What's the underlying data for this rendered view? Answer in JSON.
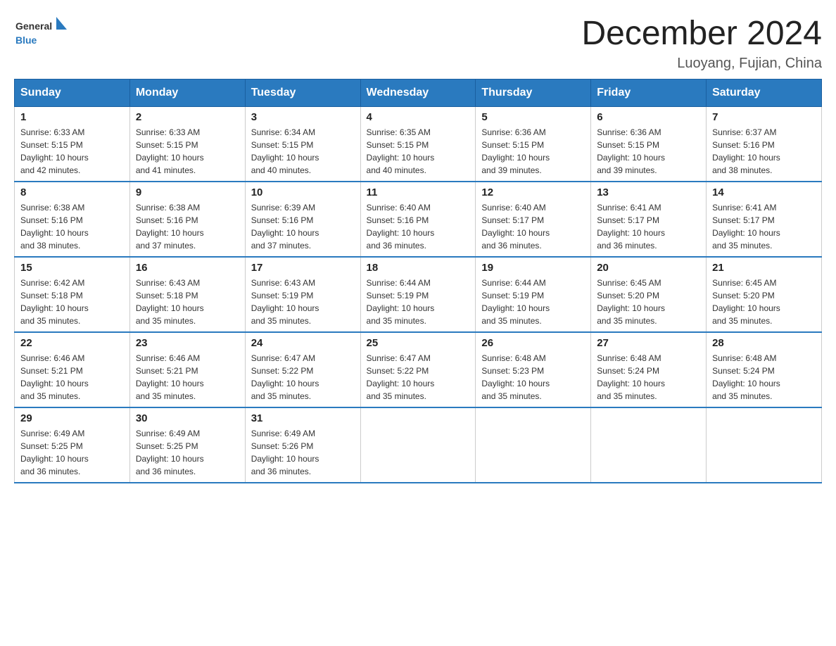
{
  "header": {
    "logo_general": "General",
    "logo_blue": "Blue",
    "month_title": "December 2024",
    "location": "Luoyang, Fujian, China"
  },
  "days_of_week": [
    "Sunday",
    "Monday",
    "Tuesday",
    "Wednesday",
    "Thursday",
    "Friday",
    "Saturday"
  ],
  "weeks": [
    [
      {
        "day": "1",
        "sunrise": "6:33 AM",
        "sunset": "5:15 PM",
        "daylight": "10 hours and 42 minutes."
      },
      {
        "day": "2",
        "sunrise": "6:33 AM",
        "sunset": "5:15 PM",
        "daylight": "10 hours and 41 minutes."
      },
      {
        "day": "3",
        "sunrise": "6:34 AM",
        "sunset": "5:15 PM",
        "daylight": "10 hours and 40 minutes."
      },
      {
        "day": "4",
        "sunrise": "6:35 AM",
        "sunset": "5:15 PM",
        "daylight": "10 hours and 40 minutes."
      },
      {
        "day": "5",
        "sunrise": "6:36 AM",
        "sunset": "5:15 PM",
        "daylight": "10 hours and 39 minutes."
      },
      {
        "day": "6",
        "sunrise": "6:36 AM",
        "sunset": "5:15 PM",
        "daylight": "10 hours and 39 minutes."
      },
      {
        "day": "7",
        "sunrise": "6:37 AM",
        "sunset": "5:16 PM",
        "daylight": "10 hours and 38 minutes."
      }
    ],
    [
      {
        "day": "8",
        "sunrise": "6:38 AM",
        "sunset": "5:16 PM",
        "daylight": "10 hours and 38 minutes."
      },
      {
        "day": "9",
        "sunrise": "6:38 AM",
        "sunset": "5:16 PM",
        "daylight": "10 hours and 37 minutes."
      },
      {
        "day": "10",
        "sunrise": "6:39 AM",
        "sunset": "5:16 PM",
        "daylight": "10 hours and 37 minutes."
      },
      {
        "day": "11",
        "sunrise": "6:40 AM",
        "sunset": "5:16 PM",
        "daylight": "10 hours and 36 minutes."
      },
      {
        "day": "12",
        "sunrise": "6:40 AM",
        "sunset": "5:17 PM",
        "daylight": "10 hours and 36 minutes."
      },
      {
        "day": "13",
        "sunrise": "6:41 AM",
        "sunset": "5:17 PM",
        "daylight": "10 hours and 36 minutes."
      },
      {
        "day": "14",
        "sunrise": "6:41 AM",
        "sunset": "5:17 PM",
        "daylight": "10 hours and 35 minutes."
      }
    ],
    [
      {
        "day": "15",
        "sunrise": "6:42 AM",
        "sunset": "5:18 PM",
        "daylight": "10 hours and 35 minutes."
      },
      {
        "day": "16",
        "sunrise": "6:43 AM",
        "sunset": "5:18 PM",
        "daylight": "10 hours and 35 minutes."
      },
      {
        "day": "17",
        "sunrise": "6:43 AM",
        "sunset": "5:19 PM",
        "daylight": "10 hours and 35 minutes."
      },
      {
        "day": "18",
        "sunrise": "6:44 AM",
        "sunset": "5:19 PM",
        "daylight": "10 hours and 35 minutes."
      },
      {
        "day": "19",
        "sunrise": "6:44 AM",
        "sunset": "5:19 PM",
        "daylight": "10 hours and 35 minutes."
      },
      {
        "day": "20",
        "sunrise": "6:45 AM",
        "sunset": "5:20 PM",
        "daylight": "10 hours and 35 minutes."
      },
      {
        "day": "21",
        "sunrise": "6:45 AM",
        "sunset": "5:20 PM",
        "daylight": "10 hours and 35 minutes."
      }
    ],
    [
      {
        "day": "22",
        "sunrise": "6:46 AM",
        "sunset": "5:21 PM",
        "daylight": "10 hours and 35 minutes."
      },
      {
        "day": "23",
        "sunrise": "6:46 AM",
        "sunset": "5:21 PM",
        "daylight": "10 hours and 35 minutes."
      },
      {
        "day": "24",
        "sunrise": "6:47 AM",
        "sunset": "5:22 PM",
        "daylight": "10 hours and 35 minutes."
      },
      {
        "day": "25",
        "sunrise": "6:47 AM",
        "sunset": "5:22 PM",
        "daylight": "10 hours and 35 minutes."
      },
      {
        "day": "26",
        "sunrise": "6:48 AM",
        "sunset": "5:23 PM",
        "daylight": "10 hours and 35 minutes."
      },
      {
        "day": "27",
        "sunrise": "6:48 AM",
        "sunset": "5:24 PM",
        "daylight": "10 hours and 35 minutes."
      },
      {
        "day": "28",
        "sunrise": "6:48 AM",
        "sunset": "5:24 PM",
        "daylight": "10 hours and 35 minutes."
      }
    ],
    [
      {
        "day": "29",
        "sunrise": "6:49 AM",
        "sunset": "5:25 PM",
        "daylight": "10 hours and 36 minutes."
      },
      {
        "day": "30",
        "sunrise": "6:49 AM",
        "sunset": "5:25 PM",
        "daylight": "10 hours and 36 minutes."
      },
      {
        "day": "31",
        "sunrise": "6:49 AM",
        "sunset": "5:26 PM",
        "daylight": "10 hours and 36 minutes."
      },
      null,
      null,
      null,
      null
    ]
  ],
  "labels": {
    "sunrise": "Sunrise:",
    "sunset": "Sunset:",
    "daylight": "Daylight:"
  }
}
